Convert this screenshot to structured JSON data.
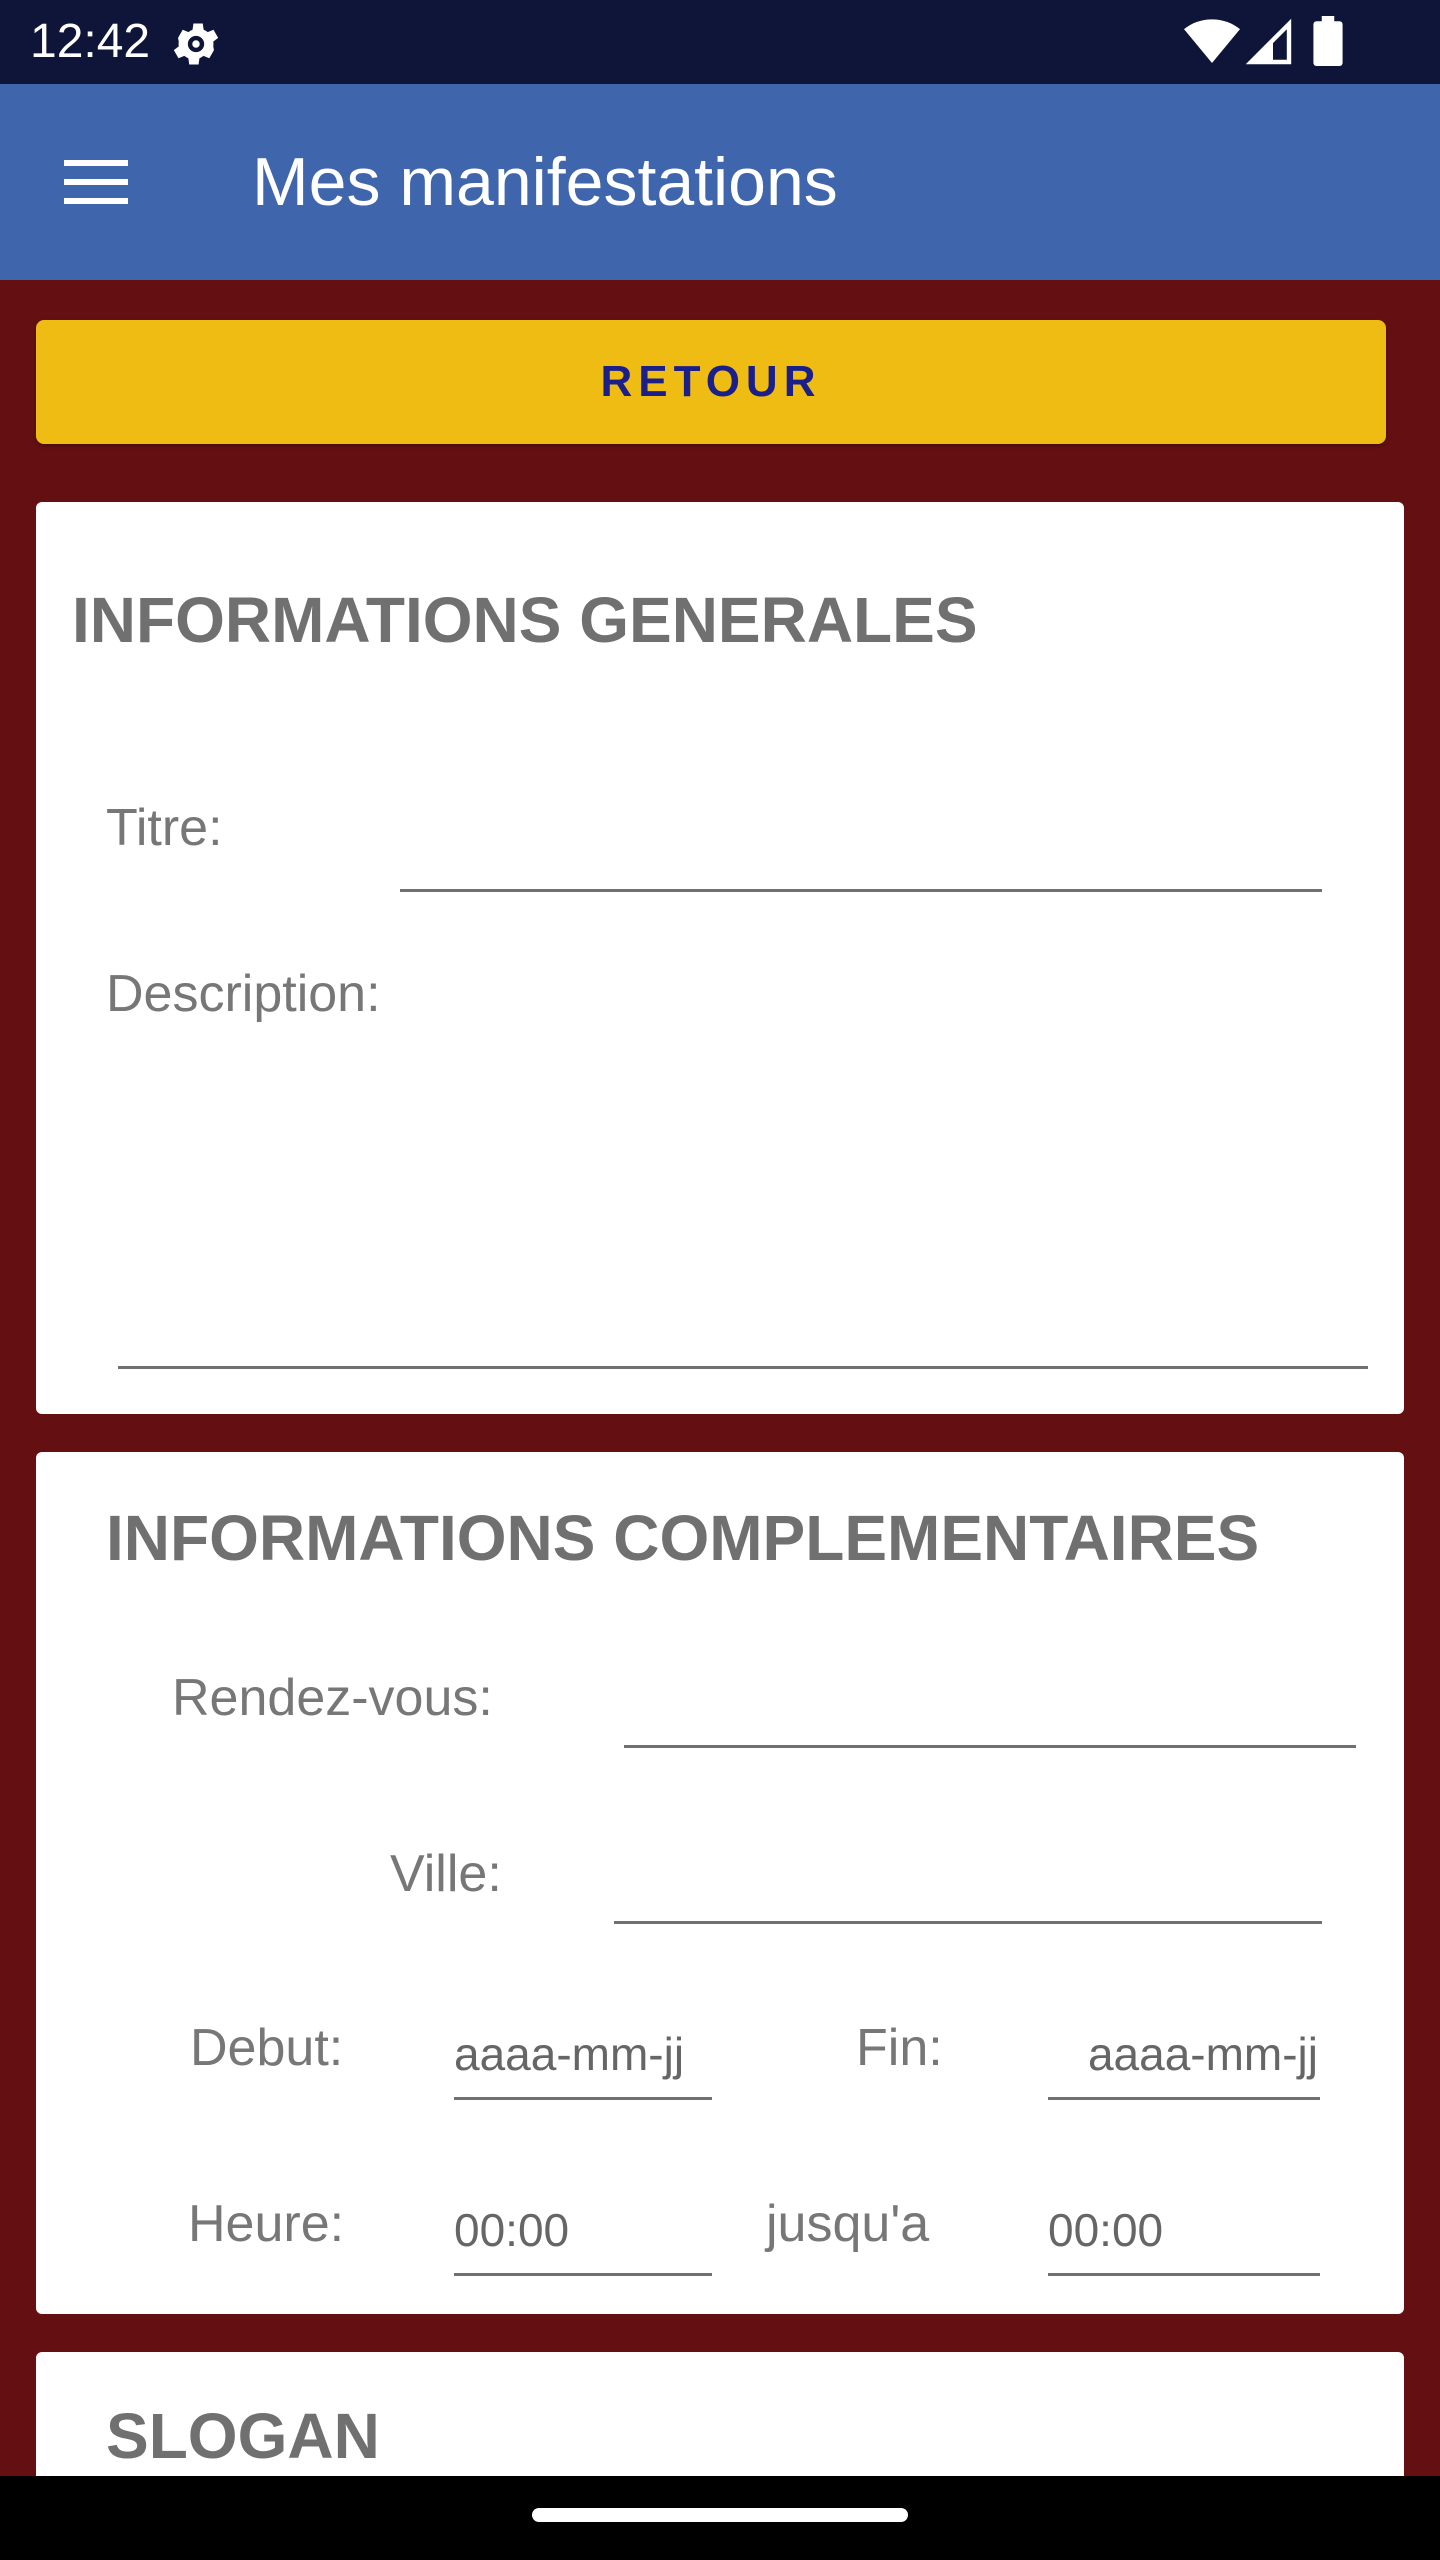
{
  "status_bar": {
    "time": "12:42",
    "icons": [
      "gear-icon",
      "wifi-icon",
      "signal-icon",
      "battery-icon"
    ]
  },
  "app_bar": {
    "title": "Mes manifestations",
    "menu_icon": "menu-icon"
  },
  "back_button": {
    "label": "RETOUR"
  },
  "general": {
    "title": "INFORMATIONS GENERALES",
    "titre_label": "Titre:",
    "titre_value": "",
    "description_label": "Description:",
    "description_value": ""
  },
  "complement": {
    "title": "INFORMATIONS COMPLEMENTAIRES",
    "rdv_label": "Rendez-vous:",
    "rdv_value": "",
    "ville_label": "Ville:",
    "ville_value": "",
    "debut_label": "Debut:",
    "debut_placeholder": "aaaa-mm-jj",
    "fin_label": "Fin:",
    "fin_placeholder": "aaaa-mm-jj",
    "heure_label": "Heure:",
    "heure_start": "00:00",
    "jusqua_label": "jusqu'a",
    "heure_end": "00:00"
  },
  "slogan": {
    "title": "SLOGAN"
  },
  "colors": {
    "background": "#641013",
    "status_bar": "#0e1538",
    "app_bar": "#3f66ac",
    "button": "#efbc13",
    "button_text": "#1b1f8a"
  }
}
